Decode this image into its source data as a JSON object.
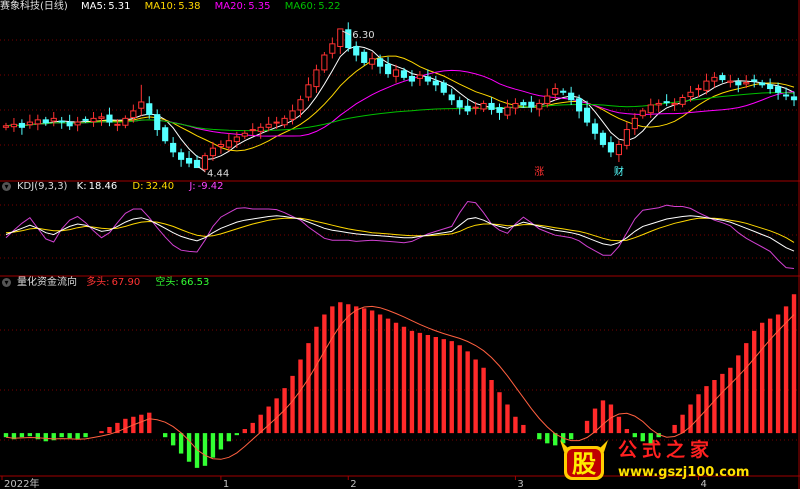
{
  "main": {
    "title": "赛象科技(日线)",
    "ma": [
      {
        "label": "MA5:",
        "value": "5.31",
        "color": "#ffffff"
      },
      {
        "label": "MA10:",
        "value": "5.38",
        "color": "#ffd800"
      },
      {
        "label": "MA20:",
        "value": "5.35",
        "color": "#ff00ff"
      },
      {
        "label": "MA60:",
        "value": "5.22",
        "color": "#00c000"
      }
    ],
    "high_label": "6.30",
    "low_label": "4.44",
    "event1": "涨",
    "event2": "财"
  },
  "kdj": {
    "title": "KDJ(9,3,3)",
    "k_label": "K:",
    "k_value": "18.46",
    "d_label": "D:",
    "d_value": "32.40",
    "j_label": "J:",
    "j_value": "-9.42"
  },
  "flow": {
    "title": "量化资金流向",
    "long_label": "多头:",
    "long_value": "67.90",
    "short_label": "空头:",
    "short_value": "66.53"
  },
  "xaxis": {
    "labels": [
      "2022年",
      "1",
      "2",
      "3",
      "4"
    ]
  },
  "watermark": {
    "glyph": "股",
    "brand": "公式之家",
    "url": "www.gszj100.com"
  },
  "colors": {
    "up": "#ff3232",
    "down": "#54ffff",
    "flow_pos": "#ff2a2a",
    "flow_neg": "#33ff33",
    "grid": "#7a0000"
  },
  "chart_data": [
    {
      "type": "candlestick",
      "ylim": [
        4.3,
        6.5
      ],
      "count": 100,
      "close": [
        5.0,
        5.02,
        4.98,
        5.05,
        5.08,
        5.04,
        5.1,
        5.06,
        5.0,
        5.05,
        5.08,
        5.1,
        5.12,
        5.05,
        5.02,
        5.1,
        5.2,
        5.32,
        5.15,
        4.95,
        4.8,
        4.65,
        4.55,
        4.5,
        4.44,
        4.6,
        4.7,
        4.75,
        4.8,
        4.85,
        4.9,
        4.95,
        4.98,
        5.02,
        5.05,
        5.1,
        5.2,
        5.35,
        5.55,
        5.75,
        5.95,
        6.1,
        6.3,
        6.05,
        5.95,
        5.85,
        5.9,
        5.8,
        5.7,
        5.75,
        5.65,
        5.6,
        5.68,
        5.6,
        5.55,
        5.45,
        5.35,
        5.25,
        5.2,
        5.25,
        5.3,
        5.22,
        5.18,
        5.25,
        5.3,
        5.28,
        5.25,
        5.3,
        5.4,
        5.5,
        5.45,
        5.35,
        5.2,
        5.05,
        4.9,
        4.75,
        4.65,
        4.75,
        4.95,
        5.1,
        5.2,
        5.28,
        5.3,
        5.32,
        5.3,
        5.38,
        5.45,
        5.5,
        5.6,
        5.65,
        5.62,
        5.6,
        5.55,
        5.58,
        5.6,
        5.55,
        5.5,
        5.45,
        5.4,
        5.35
      ],
      "ma_series": [
        "MA5",
        "MA10",
        "MA20",
        "MA60"
      ]
    },
    {
      "type": "line",
      "series_names": [
        "K",
        "D",
        "J"
      ],
      "K": [
        45,
        50,
        55,
        60,
        55,
        48,
        45,
        52,
        58,
        62,
        60,
        55,
        50,
        52,
        58,
        65,
        70,
        72,
        68,
        62,
        55,
        48,
        42,
        38,
        35,
        40,
        48,
        55,
        60,
        65,
        68,
        70,
        72,
        74,
        75,
        74,
        72,
        70,
        65,
        60,
        55,
        52,
        50,
        48,
        46,
        45,
        44,
        43,
        42,
        41,
        40,
        40,
        42,
        44,
        46,
        48,
        50,
        60,
        70,
        72,
        68,
        62,
        58,
        55,
        60,
        65,
        62,
        58,
        55,
        52,
        50,
        48,
        45,
        40,
        35,
        30,
        28,
        32,
        40,
        50,
        58,
        62,
        66,
        70,
        72,
        74,
        75,
        74,
        72,
        70,
        68,
        65,
        60,
        55,
        50,
        45,
        40,
        32,
        24,
        18.46
      ],
      "D": [
        48,
        49,
        51,
        54,
        55,
        53,
        51,
        51,
        53,
        56,
        58,
        57,
        55,
        54,
        55,
        58,
        62,
        65,
        66,
        65,
        62,
        58,
        53,
        48,
        44,
        42,
        43,
        46,
        50,
        54,
        58,
        62,
        65,
        68,
        70,
        71,
        71,
        71,
        69,
        66,
        63,
        60,
        57,
        54,
        52,
        50,
        48,
        47,
        46,
        45,
        44,
        43,
        43,
        43,
        44,
        45,
        46,
        50,
        56,
        60,
        62,
        62,
        61,
        59,
        59,
        61,
        61,
        60,
        58,
        56,
        54,
        52,
        50,
        47,
        43,
        39,
        36,
        35,
        36,
        40,
        45,
        50,
        55,
        59,
        63,
        66,
        69,
        71,
        71,
        71,
        70,
        68,
        66,
        63,
        59,
        55,
        51,
        46,
        40,
        32.4
      ],
      "J": [
        40,
        52,
        63,
        72,
        55,
        38,
        33,
        54,
        68,
        74,
        64,
        51,
        40,
        48,
        64,
        79,
        86,
        86,
        72,
        56,
        41,
        28,
        20,
        18,
        17,
        36,
        58,
        73,
        80,
        87,
        88,
        86,
        86,
        86,
        85,
        80,
        74,
        68,
        57,
        48,
        39,
        36,
        36,
        36,
        34,
        35,
        36,
        35,
        34,
        33,
        32,
        34,
        40,
        46,
        50,
        54,
        58,
        80,
        98,
        96,
        80,
        62,
        52,
        47,
        62,
        73,
        64,
        54,
        49,
        44,
        42,
        40,
        35,
        26,
        19,
        12,
        12,
        26,
        48,
        70,
        84,
        86,
        88,
        92,
        90,
        90,
        87,
        80,
        74,
        68,
        64,
        59,
        48,
        39,
        32,
        25,
        18,
        4,
        -8,
        -9.42
      ]
    },
    {
      "type": "bar",
      "series_names": [
        "多头",
        "空头"
      ],
      "values": [
        -2,
        -3,
        -2,
        -1.5,
        -3,
        -4,
        -3.5,
        -2,
        -2.5,
        -3,
        -2,
        0,
        1,
        3,
        5,
        7,
        8,
        9,
        10,
        0,
        -2,
        -6,
        -10,
        -14,
        -17,
        -16,
        -12,
        -8,
        -4,
        -1,
        2,
        5,
        9,
        13,
        17,
        22,
        28,
        36,
        44,
        52,
        58,
        62,
        64,
        63,
        62,
        61,
        60,
        58,
        56,
        54,
        52,
        50,
        49,
        48,
        47,
        46,
        45,
        43,
        40,
        36,
        32,
        26,
        20,
        14,
        8,
        4,
        0,
        -3,
        -5,
        -6,
        -5,
        -3,
        0,
        6,
        12,
        16,
        14,
        8,
        2,
        -2,
        -4,
        -6,
        -2,
        0,
        4,
        9,
        14,
        19,
        23,
        26,
        29,
        32,
        38,
        44,
        50,
        54,
        56,
        58,
        62,
        67.9
      ],
      "baseline_value": 66.53
    }
  ]
}
